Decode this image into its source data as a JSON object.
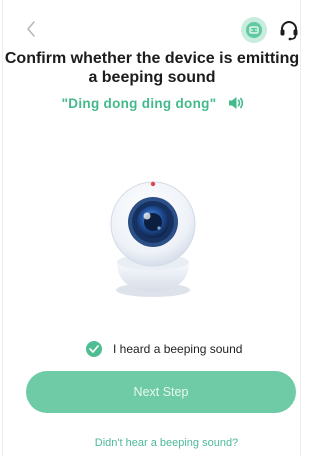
{
  "header": {
    "back_icon": "chevron-left-icon",
    "guide_icon": "device-guide-icon",
    "support_icon": "headset-icon",
    "accent_color": "#5fc9a0"
  },
  "prompt": {
    "title": "Confirm whether the device is emitting a beeping sound",
    "sound_text": "\"Ding dong ding dong\"",
    "speaker_icon": "speaker-volume-icon"
  },
  "illustration": {
    "subject": "security-camera",
    "indicator_color": "#e0464a"
  },
  "confirmation": {
    "label": "I heard a beeping sound",
    "checked": true,
    "check_color": "#4fbd92"
  },
  "actions": {
    "next_label": "Next Step",
    "next_color": "#6fcba6",
    "no_sound_link": "Didn't hear a beeping sound?"
  }
}
